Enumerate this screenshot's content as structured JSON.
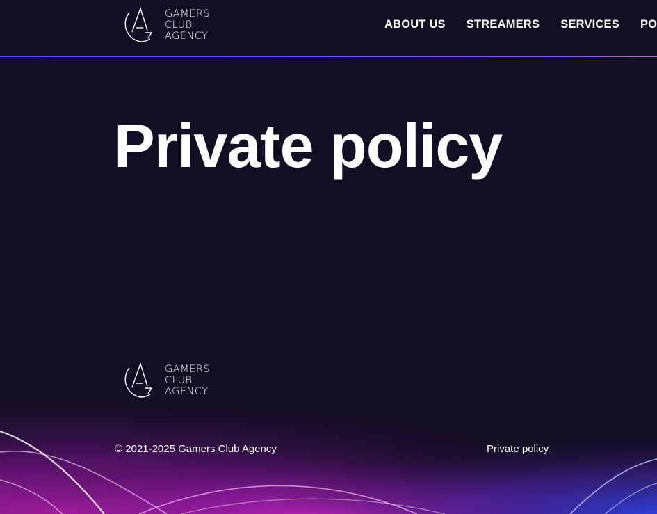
{
  "header": {
    "logo": {
      "name": "gamers-club-agency-logo",
      "lines": [
        "GAMERS",
        "CLUB",
        "AGENCY"
      ]
    },
    "nav": [
      {
        "label": "ABOUT US"
      },
      {
        "label": "STREAMERS"
      },
      {
        "label": "SERVICES"
      },
      {
        "label": "POR"
      }
    ]
  },
  "main": {
    "title": "Private policy"
  },
  "footer": {
    "logo": {
      "name": "gamers-club-agency-logo",
      "lines": [
        "GAMERS",
        "CLUB",
        "AGENCY"
      ]
    },
    "copyright": "© 2021-2025 Gamers Club Agency",
    "privacy_link": "Private policy"
  },
  "colors": {
    "background": "#130e24",
    "text": "#ffffff",
    "accent_blue": "#3b4fd8",
    "accent_magenta": "#d02ad0"
  }
}
